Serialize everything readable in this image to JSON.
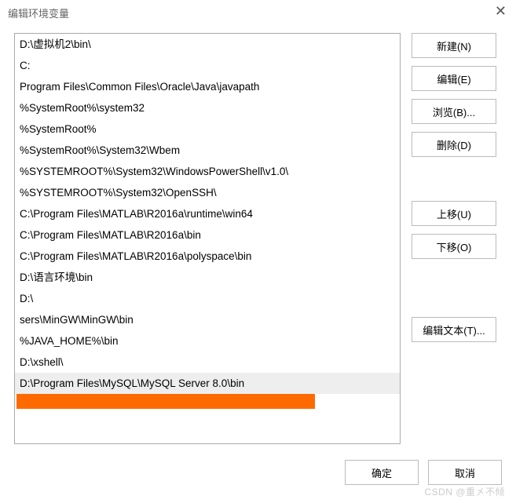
{
  "window": {
    "title": "编辑环境变量",
    "close_glyph": "✕"
  },
  "list": {
    "items": [
      "D:\\虚拟机2\\bin\\",
      "C:",
      "Program Files\\Common Files\\Oracle\\Java\\javapath",
      "%SystemRoot%\\system32",
      "%SystemRoot%",
      "%SystemRoot%\\System32\\Wbem",
      "%SYSTEMROOT%\\System32\\WindowsPowerShell\\v1.0\\",
      "%SYSTEMROOT%\\System32\\OpenSSH\\",
      "C:\\Program Files\\MATLAB\\R2016a\\runtime\\win64",
      "C:\\Program Files\\MATLAB\\R2016a\\bin",
      "C:\\Program Files\\MATLAB\\R2016a\\polyspace\\bin",
      "D:\\语言环境\\bin",
      "D:\\",
      "sers\\MinGW\\MinGW\\bin",
      "%JAVA_HOME%\\bin",
      "D:\\xshell\\",
      "D:\\Program Files\\MySQL\\MySQL Server 8.0\\bin"
    ],
    "selected_index": 16
  },
  "buttons": {
    "new": "新建(N)",
    "edit": "编辑(E)",
    "browse": "浏览(B)...",
    "delete": "删除(D)",
    "move_up": "上移(U)",
    "move_down": "下移(O)",
    "edit_text": "编辑文本(T)...",
    "ok": "确定",
    "cancel": "取消"
  },
  "watermark": "CSDN @重㐅不倾"
}
